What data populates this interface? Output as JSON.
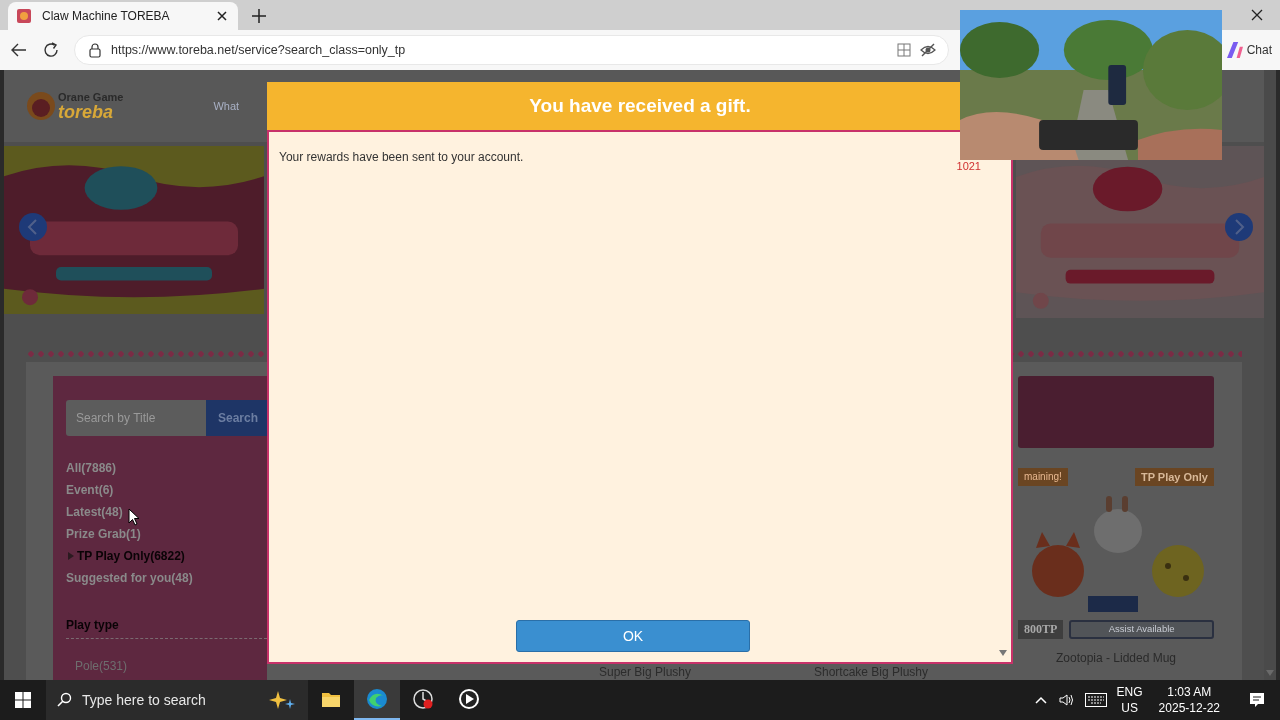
{
  "browser": {
    "tab": {
      "title": "Claw Machine TOREBA",
      "selected": true
    },
    "url": "https://www.toreba.net/service?search_class=only_tp",
    "chat_label": "Chat"
  },
  "site": {
    "logo": {
      "line_1": "Orane Game",
      "line_2": "toreba"
    },
    "nav": [
      "What"
    ],
    "sidebar": {
      "search": {
        "placeholder": "Search by Title",
        "button": "Search"
      },
      "categories": [
        {
          "label": "All(7886)",
          "selected": false
        },
        {
          "label": "Event(6)",
          "selected": false
        },
        {
          "label": "Latest(48)",
          "selected": false
        },
        {
          "label": "Prize Grab(1)",
          "selected": false
        },
        {
          "label": "TP Play Only(6822)",
          "selected": true
        },
        {
          "label": "Suggested for you(48)",
          "selected": false
        }
      ],
      "section_title": "Play type",
      "play_types": [
        "Pole(531)"
      ]
    },
    "product": {
      "badges": [
        "maining!",
        "TP Play Only"
      ],
      "price": "800TP",
      "assist": "Assist Available",
      "name": "Zootopia - Lidded Mug"
    },
    "bottom_labels": [
      "Super Big Plushy",
      "Shortcake Big Plushy"
    ]
  },
  "dialog": {
    "title": "You have received a gift.",
    "message": "Your rewards have been sent to your account.",
    "note": "1021",
    "ok": "OK"
  },
  "taskbar": {
    "search_placeholder": "Type here to search",
    "apps": [
      {
        "kind": "explorer",
        "selected": false
      },
      {
        "kind": "edge",
        "selected": true
      },
      {
        "kind": "recorder",
        "selected": false
      },
      {
        "kind": "player",
        "selected": false
      }
    ],
    "language": "ENG",
    "region": "US",
    "time": "1:03 AM",
    "date": "2025-12-22"
  }
}
